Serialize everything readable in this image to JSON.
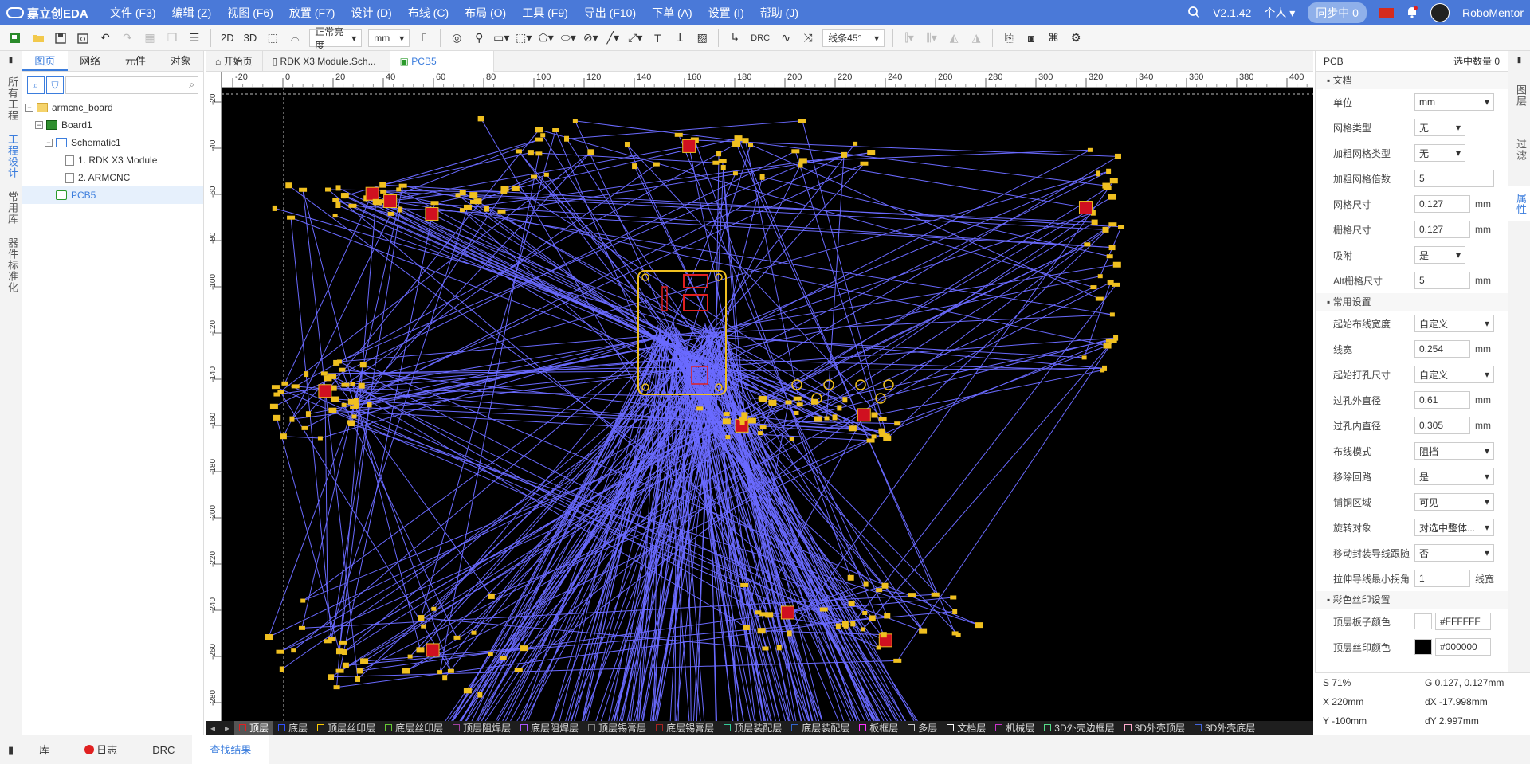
{
  "app": {
    "logo": "嘉立创EDA",
    "menu": [
      "文件 (F3)",
      "编辑 (Z)",
      "视图 (F6)",
      "放置 (F7)",
      "设计 (D)",
      "布线 (C)",
      "布局 (O)",
      "工具 (F9)",
      "导出 (F10)",
      "下单 (A)",
      "设置 (I)",
      "帮助 (J)"
    ],
    "version": "V2.1.42",
    "account_type": "个人",
    "sync_label": "同步中",
    "sync_count": "0",
    "username": "RoboMentor"
  },
  "toolbar": {
    "view_2d": "2D",
    "view_3d": "3D",
    "brightness": "正常亮度",
    "unit": "mm",
    "route_angle": "线条45°",
    "drc": "DRC"
  },
  "left_vtabs": [
    "所有工程",
    "工程设计",
    "常用库",
    "器件标准化"
  ],
  "left_panel": {
    "tabs": [
      "图页",
      "网络",
      "元件",
      "对象"
    ],
    "search_placeholder": "",
    "tree": [
      {
        "label": "armcnc_board",
        "level": 0,
        "icon": "folder-icon"
      },
      {
        "label": "Board1",
        "level": 1,
        "icon": "board-icon"
      },
      {
        "label": "Schematic1",
        "level": 2,
        "icon": "schematic-icon"
      },
      {
        "label": "1. RDK X3 Module",
        "level": 3,
        "icon": "document-icon"
      },
      {
        "label": "2. ARMCNC",
        "level": 3,
        "icon": "document-icon"
      },
      {
        "label": "PCB5",
        "level": 2,
        "icon": "pcb-icon"
      }
    ]
  },
  "doc_tabs": [
    "开始页",
    "RDK X3 Module.Sch...",
    "PCB5"
  ],
  "ruler": {
    "top_ticks": [
      "-20",
      "0",
      "20",
      "40",
      "60",
      "80",
      "100",
      "120",
      "140",
      "160",
      "180",
      "200",
      "220",
      "240",
      "260",
      "280",
      "300",
      "320",
      "340",
      "360",
      "380",
      "400"
    ],
    "left_ticks": [
      "-20",
      "-40",
      "-60",
      "-80",
      "-100",
      "-120",
      "-140",
      "-160",
      "-180",
      "-200",
      "-220",
      "-240",
      "-260",
      "-280"
    ]
  },
  "layers": [
    {
      "name": "顶层",
      "color": "#e02020"
    },
    {
      "name": "底层",
      "color": "#3050ff"
    },
    {
      "name": "顶层丝印层",
      "color": "#ffcc00"
    },
    {
      "name": "底层丝印层",
      "color": "#66cc33"
    },
    {
      "name": "顶层阻焊层",
      "color": "#a040a0"
    },
    {
      "name": "底层阻焊层",
      "color": "#aa55ff"
    },
    {
      "name": "顶层锡膏层",
      "color": "#808080"
    },
    {
      "name": "底层锡膏层",
      "color": "#aa2222"
    },
    {
      "name": "顶层装配层",
      "color": "#33cc99"
    },
    {
      "name": "底层装配层",
      "color": "#3366cc"
    },
    {
      "name": "板框层",
      "color": "#ff33ff"
    },
    {
      "name": "多层",
      "color": "#cccccc"
    },
    {
      "name": "文档层",
      "color": "#ffffff"
    },
    {
      "name": "机械层",
      "color": "#cc33cc"
    },
    {
      "name": "3D外壳边框层",
      "color": "#55dd88"
    },
    {
      "name": "3D外壳顶层",
      "color": "#ffaacc"
    },
    {
      "name": "3D外壳底层",
      "color": "#4466dd"
    }
  ],
  "right_vtabs": [
    "图层",
    "过滤",
    "属性"
  ],
  "props": {
    "title": "PCB",
    "selected_label": "选中数量",
    "selected_count": "0",
    "section_doc": "文档",
    "section_common": "常用设置",
    "section_color": "彩色丝印设置",
    "rows": [
      {
        "label": "单位",
        "type": "select",
        "value": "mm"
      },
      {
        "label": "网格类型",
        "type": "select-short",
        "value": "无"
      },
      {
        "label": "加粗网格类型",
        "type": "select-short",
        "value": "无"
      },
      {
        "label": "加粗网格倍数",
        "type": "input-wide",
        "value": "5"
      },
      {
        "label": "网格尺寸",
        "type": "input",
        "value": "0.127",
        "unit": "mm"
      },
      {
        "label": "栅格尺寸",
        "type": "input",
        "value": "0.127",
        "unit": "mm"
      },
      {
        "label": "吸附",
        "type": "select-short",
        "value": "是"
      },
      {
        "label": "Alt栅格尺寸",
        "type": "input",
        "value": "5",
        "unit": "mm"
      }
    ],
    "rows2": [
      {
        "label": "起始布线宽度",
        "type": "select",
        "value": "自定义"
      },
      {
        "label": "线宽",
        "type": "input",
        "value": "0.254",
        "unit": "mm"
      },
      {
        "label": "起始打孔尺寸",
        "type": "select",
        "value": "自定义"
      },
      {
        "label": "过孔外直径",
        "type": "input",
        "value": "0.61",
        "unit": "mm"
      },
      {
        "label": "过孔内直径",
        "type": "input",
        "value": "0.305",
        "unit": "mm"
      },
      {
        "label": "布线模式",
        "type": "select",
        "value": "阻挡"
      },
      {
        "label": "移除回路",
        "type": "select",
        "value": "是"
      },
      {
        "label": "铺铜区域",
        "type": "select",
        "value": "可见"
      },
      {
        "label": "旋转对象",
        "type": "select",
        "value": "对选中整体..."
      },
      {
        "label": "移动封装导线跟随",
        "type": "select",
        "value": "否"
      },
      {
        "label": "拉伸导线最小拐角",
        "type": "input",
        "value": "1",
        "unit": "线宽"
      }
    ],
    "rows3": [
      {
        "label": "顶层板子颜色",
        "swatch": "#FFFFFF",
        "value": "#FFFFFF"
      },
      {
        "label": "顶层丝印颜色",
        "swatch": "#000000",
        "value": "#000000"
      }
    ]
  },
  "status": {
    "s": "S  71%",
    "g": "G  0.127, 0.127mm",
    "x": "X  220mm",
    "dx": "dX  -17.998mm",
    "y": "Y  -100mm",
    "dy": "dY  2.997mm"
  },
  "bottom_tabs": [
    "库",
    "日志",
    "DRC",
    "查找结果"
  ]
}
